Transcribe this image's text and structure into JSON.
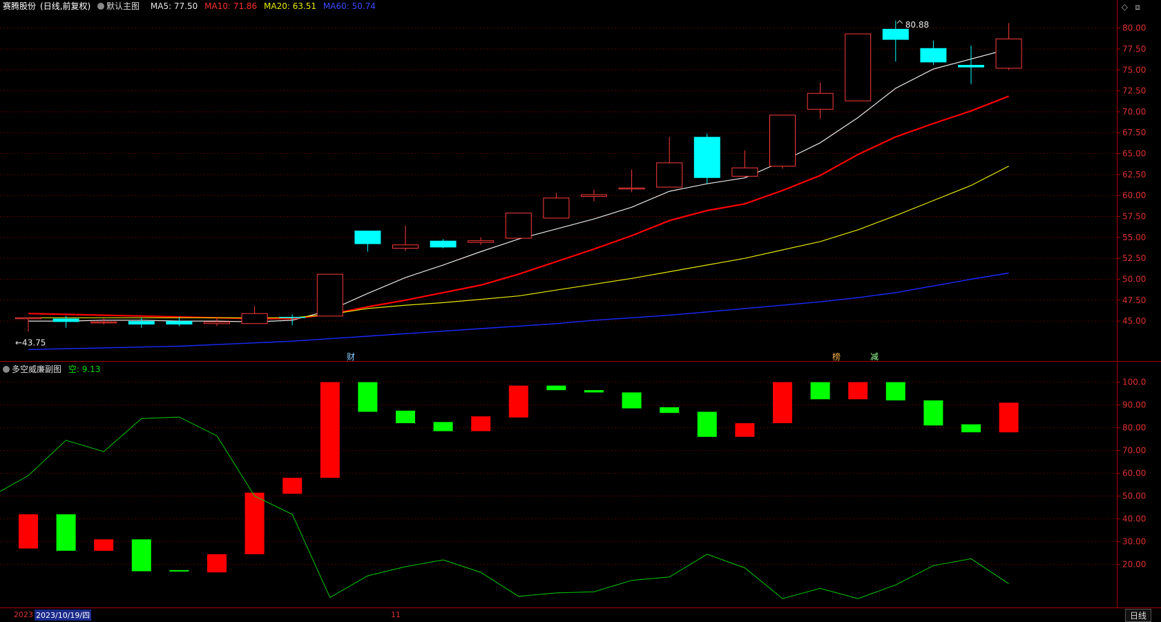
{
  "header": {
    "stock_name": "赛腾股份",
    "period_tag": "(日线,前复权)",
    "main_chart_label": "默认主图",
    "ma5": "MA5: 77.50",
    "ma10": "MA10: 71.86",
    "ma20": "MA20: 63.51",
    "ma60": "MA60: 50.74"
  },
  "sub_header": {
    "indicator_name": "多空威廉副图",
    "value": "空: 9.13"
  },
  "markers": {
    "cai": "财",
    "duo": "榜",
    "jian": "减"
  },
  "bottom": {
    "year": "2023",
    "selected_date": "2023/10/19/四",
    "month_tick": "11",
    "period_button": "日线"
  },
  "colors": {
    "up": "#ff3b3b",
    "down": "#00ffff",
    "ma5": "#e8e8e8",
    "ma10": "#ff0000",
    "ma20": "#e8e800",
    "ma60": "#1a2aff",
    "wr_line": "#00cc00",
    "bar_red": "#ff0000",
    "bar_green": "#00ff00",
    "axis": "#aa0000"
  },
  "chart_data": [
    {
      "type": "candlestick",
      "y_ticks": [
        "80.00",
        "77.50",
        "75.00",
        "72.50",
        "70.00",
        "67.50",
        "65.00",
        "62.50",
        "60.00",
        "57.50",
        "55.00",
        "52.50",
        "50.00",
        "47.50",
        "45.00"
      ],
      "ylim": [
        41.3,
        81.7
      ],
      "high_label": "80.88",
      "low_label": "43.75",
      "candles": [
        {
          "o": 45.4,
          "c": 45.4,
          "h": 45.4,
          "l": 43.75
        },
        {
          "o": 45.3,
          "c": 44.9,
          "h": 45.6,
          "l": 44.2
        },
        {
          "o": 44.8,
          "c": 44.9,
          "h": 45.3,
          "l": 44.6
        },
        {
          "o": 45.0,
          "c": 44.6,
          "h": 45.4,
          "l": 44.2
        },
        {
          "o": 45.0,
          "c": 44.6,
          "h": 45.5,
          "l": 44.4
        },
        {
          "o": 44.7,
          "c": 44.9,
          "h": 45.5,
          "l": 44.4
        },
        {
          "o": 44.7,
          "c": 45.9,
          "h": 46.8,
          "l": 44.7
        },
        {
          "o": 45.5,
          "c": 45.4,
          "h": 45.8,
          "l": 44.5
        },
        {
          "o": 45.6,
          "c": 50.6,
          "h": 50.6,
          "l": 45.6
        },
        {
          "o": 55.8,
          "c": 54.2,
          "h": 55.8,
          "l": 53.3
        },
        {
          "o": 53.7,
          "c": 54.1,
          "h": 56.4,
          "l": 53.4
        },
        {
          "o": 54.6,
          "c": 53.8,
          "h": 54.8,
          "l": 53.7
        },
        {
          "o": 54.4,
          "c": 54.6,
          "h": 55.0,
          "l": 54.1
        },
        {
          "o": 54.9,
          "c": 57.9,
          "h": 57.9,
          "l": 54.9
        },
        {
          "o": 57.3,
          "c": 59.7,
          "h": 60.3,
          "l": 57.3
        },
        {
          "o": 59.9,
          "c": 60.1,
          "h": 60.7,
          "l": 59.3
        },
        {
          "o": 60.8,
          "c": 60.9,
          "h": 63.1,
          "l": 60.4
        },
        {
          "o": 61.0,
          "c": 63.9,
          "h": 67.0,
          "l": 61.0
        },
        {
          "o": 67.0,
          "c": 62.1,
          "h": 67.4,
          "l": 61.4
        },
        {
          "o": 62.3,
          "c": 63.3,
          "h": 65.4,
          "l": 62.2
        },
        {
          "o": 63.5,
          "c": 69.6,
          "h": 69.6,
          "l": 63.2
        },
        {
          "o": 70.3,
          "c": 72.2,
          "h": 73.5,
          "l": 69.2
        },
        {
          "o": 71.3,
          "c": 79.3,
          "h": 79.3,
          "l": 71.3
        },
        {
          "o": 79.9,
          "c": 78.6,
          "h": 80.88,
          "l": 76.0
        },
        {
          "o": 77.6,
          "c": 75.9,
          "h": 78.5,
          "l": 75.6
        },
        {
          "o": 75.6,
          "c": 75.3,
          "h": 77.9,
          "l": 73.3
        },
        {
          "o": 75.2,
          "c": 78.7,
          "h": 80.6,
          "l": 75.0
        }
      ],
      "ma_series": [
        {
          "name": "MA5",
          "values": [
            45.0,
            45.0,
            45.1,
            45.1,
            45.0,
            45.0,
            44.9,
            45.1,
            46.3,
            48.3,
            50.2,
            51.7,
            53.3,
            54.8,
            56.0,
            57.2,
            58.6,
            60.5,
            61.4,
            62.1,
            64.1,
            66.3,
            69.3,
            72.8,
            75.1,
            76.3,
            77.5
          ]
        },
        {
          "name": "MA10",
          "values": [
            45.9,
            45.8,
            45.7,
            45.6,
            45.5,
            45.4,
            45.3,
            45.3,
            45.8,
            46.7,
            47.5,
            48.4,
            49.3,
            50.6,
            52.1,
            53.6,
            55.2,
            57.0,
            58.2,
            59.0,
            60.6,
            62.4,
            64.9,
            67.0,
            68.6,
            70.1,
            71.86
          ]
        },
        {
          "name": "MA20",
          "values": [
            45.4,
            45.4,
            45.4,
            45.4,
            45.4,
            45.4,
            45.4,
            45.4,
            45.8,
            46.5,
            46.9,
            47.2,
            47.6,
            48.0,
            48.7,
            49.4,
            50.1,
            50.9,
            51.7,
            52.5,
            53.5,
            54.5,
            55.9,
            57.6,
            59.4,
            61.2,
            63.51
          ]
        },
        {
          "name": "MA60",
          "values": [
            41.6,
            41.7,
            41.8,
            41.9,
            42.0,
            42.2,
            42.4,
            42.6,
            42.9,
            43.2,
            43.5,
            43.8,
            44.1,
            44.4,
            44.7,
            45.1,
            45.4,
            45.7,
            46.1,
            46.5,
            46.9,
            47.3,
            47.8,
            48.4,
            49.2,
            50.0,
            50.74
          ]
        }
      ]
    },
    {
      "type": "bar",
      "name": "多空威廉副图",
      "y_ticks": [
        "100.0",
        "90.00",
        "80.00",
        "70.00",
        "60.00",
        "50.00",
        "40.00",
        "30.00",
        "20.00"
      ],
      "ylim": [
        2,
        102
      ],
      "bars": [
        {
          "lo": 27.0,
          "hi": 42.0,
          "color": "red"
        },
        {
          "lo": 26.0,
          "hi": 42.0,
          "color": "green"
        },
        {
          "lo": 26.0,
          "hi": 31.0,
          "color": "red"
        },
        {
          "lo": 17.0,
          "hi": 31.0,
          "color": "green"
        },
        {
          "lo": 17.0,
          "hi": 17.5,
          "color": "green"
        },
        {
          "lo": 16.5,
          "hi": 24.5,
          "color": "red"
        },
        {
          "lo": 24.5,
          "hi": 51.5,
          "color": "red"
        },
        {
          "lo": 51.0,
          "hi": 58.0,
          "color": "red"
        },
        {
          "lo": 58.0,
          "hi": 100.0,
          "color": "red"
        },
        {
          "lo": 87.0,
          "hi": 100.0,
          "color": "green"
        },
        {
          "lo": 82.0,
          "hi": 87.5,
          "color": "green"
        },
        {
          "lo": 78.5,
          "hi": 82.5,
          "color": "green"
        },
        {
          "lo": 78.5,
          "hi": 85.0,
          "color": "red"
        },
        {
          "lo": 84.5,
          "hi": 98.5,
          "color": "red"
        },
        {
          "lo": 96.5,
          "hi": 98.5,
          "color": "green"
        },
        {
          "lo": 95.5,
          "hi": 96.5,
          "color": "green"
        },
        {
          "lo": 88.5,
          "hi": 95.5,
          "color": "green"
        },
        {
          "lo": 86.5,
          "hi": 89.0,
          "color": "green"
        },
        {
          "lo": 76.0,
          "hi": 87.0,
          "color": "green"
        },
        {
          "lo": 76.0,
          "hi": 82.0,
          "color": "red"
        },
        {
          "lo": 82.0,
          "hi": 100.0,
          "color": "red"
        },
        {
          "lo": 92.5,
          "hi": 100.0,
          "color": "green"
        },
        {
          "lo": 92.5,
          "hi": 100.0,
          "color": "red"
        },
        {
          "lo": 92.0,
          "hi": 100.0,
          "color": "green"
        },
        {
          "lo": 81.0,
          "hi": 92.0,
          "color": "green"
        },
        {
          "lo": 78.0,
          "hi": 81.5,
          "color": "green"
        },
        {
          "lo": 78.0,
          "hi": 91.0,
          "color": "red"
        }
      ],
      "line_values": [
        59.0,
        74.5,
        69.5,
        84.0,
        84.7,
        76.5,
        50.0,
        42.0,
        5.5,
        15.0,
        19.0,
        22.0,
        16.5,
        6.0,
        7.5,
        8.0,
        13.0,
        14.5,
        24.5,
        18.5,
        5.0,
        9.5,
        5.0,
        11.0,
        19.5,
        22.5,
        11.5
      ]
    }
  ]
}
